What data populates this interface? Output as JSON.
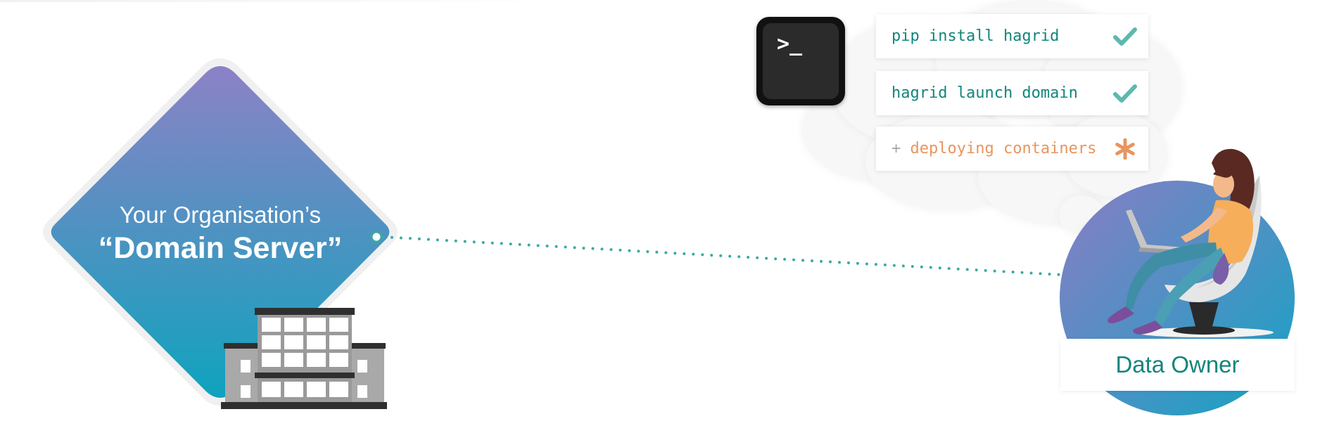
{
  "domain_server": {
    "line1": "Your Organisation’s",
    "line2": "“Domain Server”"
  },
  "terminal": {
    "icon": "terminal-icon",
    "prompt": ">_"
  },
  "commands": [
    {
      "prefix": "",
      "text": "pip install hagrid",
      "status": "done",
      "status_icon": "check-icon"
    },
    {
      "prefix": "",
      "text": "hagrid launch domain",
      "status": "done",
      "status_icon": "check-icon"
    },
    {
      "prefix": "+ ",
      "text": "deploying containers",
      "status": "in-progress",
      "status_icon": "asterisk-icon"
    }
  ],
  "data_owner": {
    "label": "Data Owner",
    "illustration": "woman-with-laptop-icon"
  },
  "colors": {
    "diamond_top": "#8c82c6",
    "diamond_bottom": "#0fa3bd",
    "teal_text": "#13857c",
    "dotted_line": "#3aa9a3",
    "check": "#5fb8ae",
    "pending": "#e8955f"
  }
}
